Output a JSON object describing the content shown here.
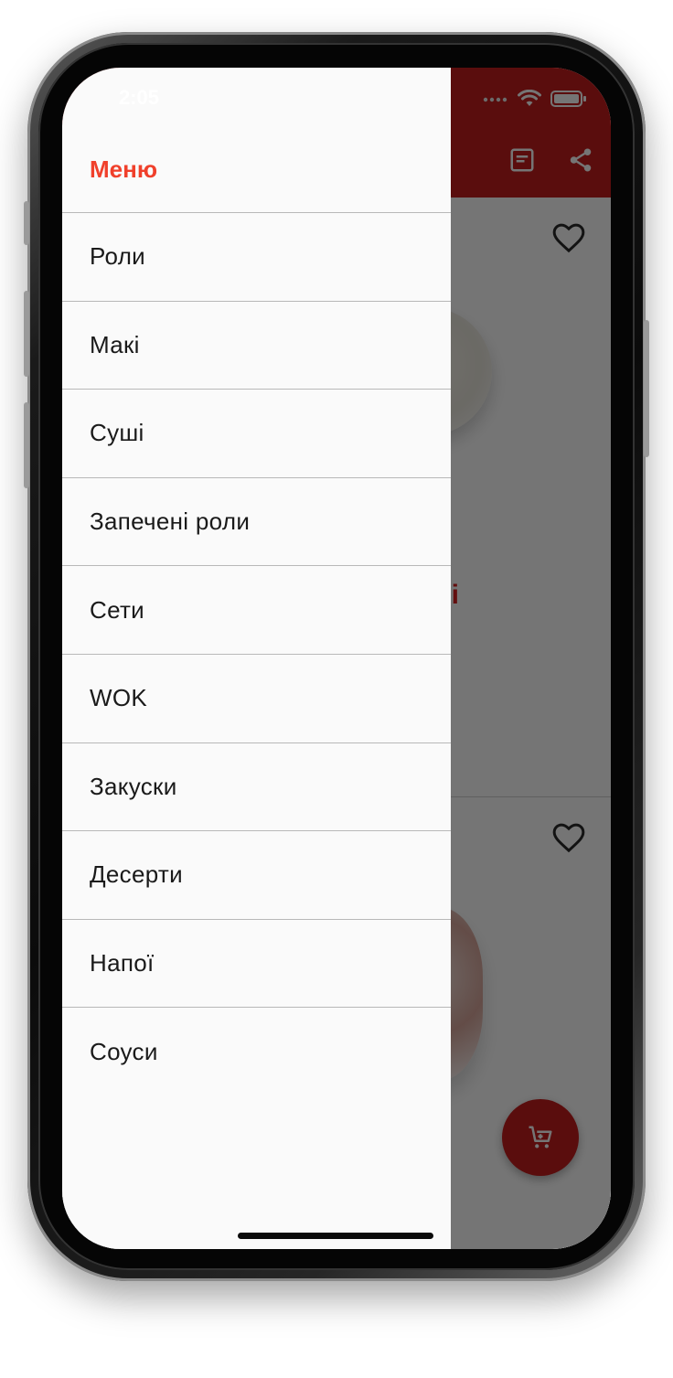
{
  "status_bar": {
    "time": "2:05"
  },
  "app_bar": {
    "actions": [
      "article-icon",
      "share-icon"
    ]
  },
  "products": {
    "partial_title_fragment": "і"
  },
  "drawer": {
    "title": "Меню",
    "items": [
      "Роли",
      "Макі",
      "Суші",
      "Запечені роли",
      "Сети",
      "WOK",
      "Закуски",
      "Десерти",
      "Напої",
      "Соуси"
    ]
  },
  "colors": {
    "brand_red": "#c41e1e",
    "drawer_title": "#f0402b",
    "drawer_bg": "#fafafa",
    "scrim": "rgba(0,0,0,0.54)"
  }
}
